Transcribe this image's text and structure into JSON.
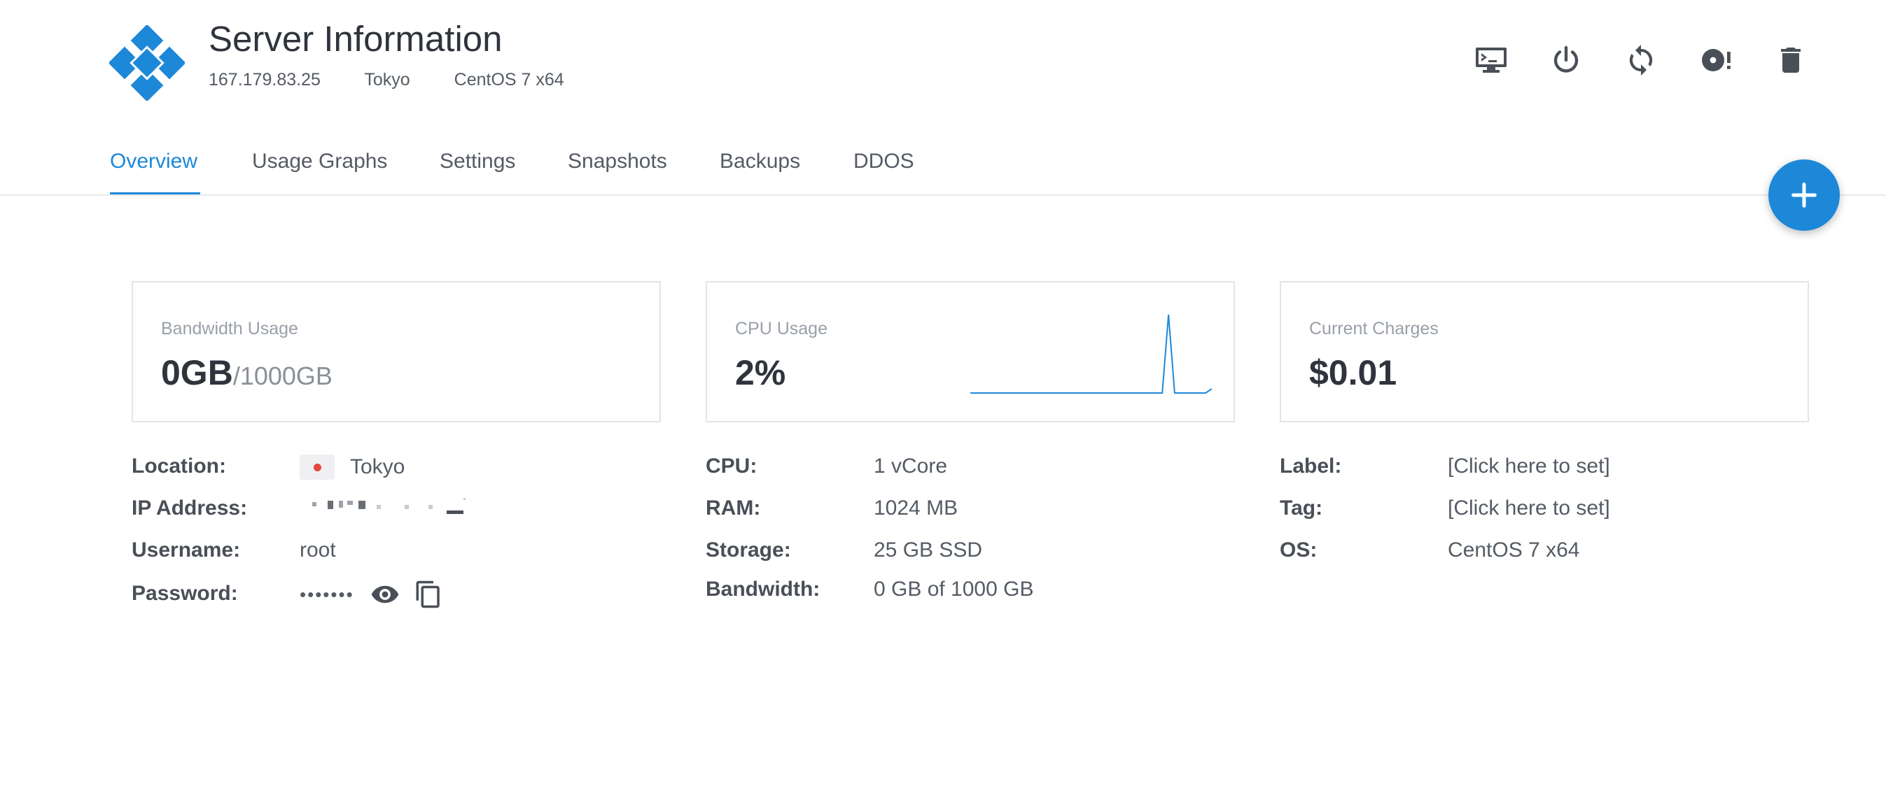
{
  "header": {
    "title": "Server Information",
    "ip": "167.179.83.25",
    "location": "Tokyo",
    "os": "CentOS 7 x64"
  },
  "toolbar": {
    "icons": [
      "console-icon",
      "power-icon",
      "restart-icon",
      "reinstall-icon",
      "delete-icon"
    ]
  },
  "tabs": [
    {
      "label": "Overview",
      "active": true
    },
    {
      "label": "Usage Graphs",
      "active": false
    },
    {
      "label": "Settings",
      "active": false
    },
    {
      "label": "Snapshots",
      "active": false
    },
    {
      "label": "Backups",
      "active": false
    },
    {
      "label": "DDOS",
      "active": false
    }
  ],
  "fab": {
    "icon": "plus-icon"
  },
  "cards": {
    "bandwidth": {
      "label": "Bandwidth Usage",
      "value": "0GB",
      "sub": "/1000GB"
    },
    "cpu": {
      "label": "CPU Usage",
      "value": "2%"
    },
    "charges": {
      "label": "Current Charges",
      "value": "$0.01"
    }
  },
  "cpu_sparkline": [
    0,
    0,
    0,
    0,
    0,
    0,
    0,
    0,
    0,
    0,
    0,
    0,
    0,
    0,
    0,
    0,
    0,
    0,
    0,
    0,
    0,
    0,
    0,
    0,
    0,
    0,
    0,
    0,
    0,
    0,
    0,
    0,
    95,
    0,
    0,
    0,
    0,
    0,
    0,
    5
  ],
  "info_left": {
    "location_label": "Location:",
    "location_value": "Tokyo",
    "ip_label": "IP Address:",
    "username_label": "Username:",
    "username_value": "root",
    "password_label": "Password:",
    "password_dots": "•••••••"
  },
  "info_mid": {
    "cpu_label": "CPU:",
    "cpu_value": "1 vCore",
    "ram_label": "RAM:",
    "ram_value": "1024 MB",
    "storage_label": "Storage:",
    "storage_value": "25 GB SSD",
    "bandwidth_label": "Bandwidth:",
    "bandwidth_value": "0 GB of 1000 GB"
  },
  "info_right": {
    "label_label": "Label:",
    "label_value": "[Click here to set]",
    "tag_label": "Tag:",
    "tag_value": "[Click here to set]",
    "os_label": "OS:",
    "os_value": "CentOS 7 x64"
  },
  "colors": {
    "accent": "#1e88d8",
    "flag_red": "#e2483d",
    "text": "#3a3f48"
  }
}
